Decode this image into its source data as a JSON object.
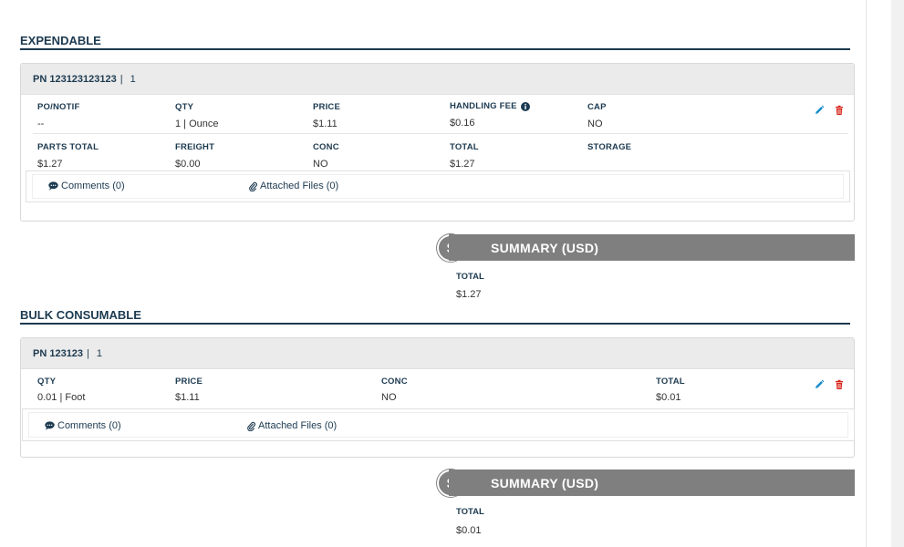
{
  "expendable": {
    "section_title": "EXPENDABLE",
    "part_number": "PN 123123123123",
    "pipe": "|",
    "qty_header": "1",
    "fields_row1": [
      {
        "label": "PO/NOTIF",
        "value": "--"
      },
      {
        "label": "QTY",
        "value": "1 | Ounce"
      },
      {
        "label": "PRICE",
        "value": "$1.11"
      },
      {
        "label": "HANDLING FEE",
        "value": "$0.16"
      },
      {
        "label": "CAP",
        "value": "NO"
      }
    ],
    "fields_row2": [
      {
        "label": "PARTS TOTAL",
        "value": "$1.27"
      },
      {
        "label": "FREIGHT",
        "value": "$0.00"
      },
      {
        "label": "CONC",
        "value": "NO"
      },
      {
        "label": "TOTAL",
        "value": "$1.27"
      },
      {
        "label": "STORAGE",
        "value": ""
      }
    ],
    "comments_label": "Comments (0)",
    "attached_label": "Attached Files (0)",
    "summary": {
      "title": "SUMMARY (USD)",
      "currency_symbol": "$",
      "total_label": "TOTAL",
      "total_value": "$1.27"
    }
  },
  "bulk_consumable": {
    "section_title": "BULK CONSUMABLE",
    "part_number": "PN 123123",
    "pipe": "|",
    "qty_header": "1",
    "fields": [
      {
        "label": "QTY",
        "value": "0.01 | Foot"
      },
      {
        "label": "PRICE",
        "value": "$1.11"
      },
      {
        "label": "CONC",
        "value": "NO"
      },
      {
        "label": "TOTAL",
        "value": "$0.01"
      }
    ],
    "comments_label": "Comments (0)",
    "attached_label": "Attached Files (0)",
    "summary": {
      "title": "SUMMARY (USD)",
      "currency_symbol": "$",
      "total_label": "TOTAL",
      "total_value": "$0.01"
    }
  },
  "colors": {
    "accent": "#1c3a50",
    "edit": "#1a8fc9",
    "delete": "#d9261c",
    "summary_bar": "#7f7f7f"
  },
  "icons": {
    "edit": "pencil-icon",
    "delete": "trash-icon",
    "info": "info-circle-icon",
    "comments": "comment-icon",
    "attach": "paperclip-icon"
  }
}
